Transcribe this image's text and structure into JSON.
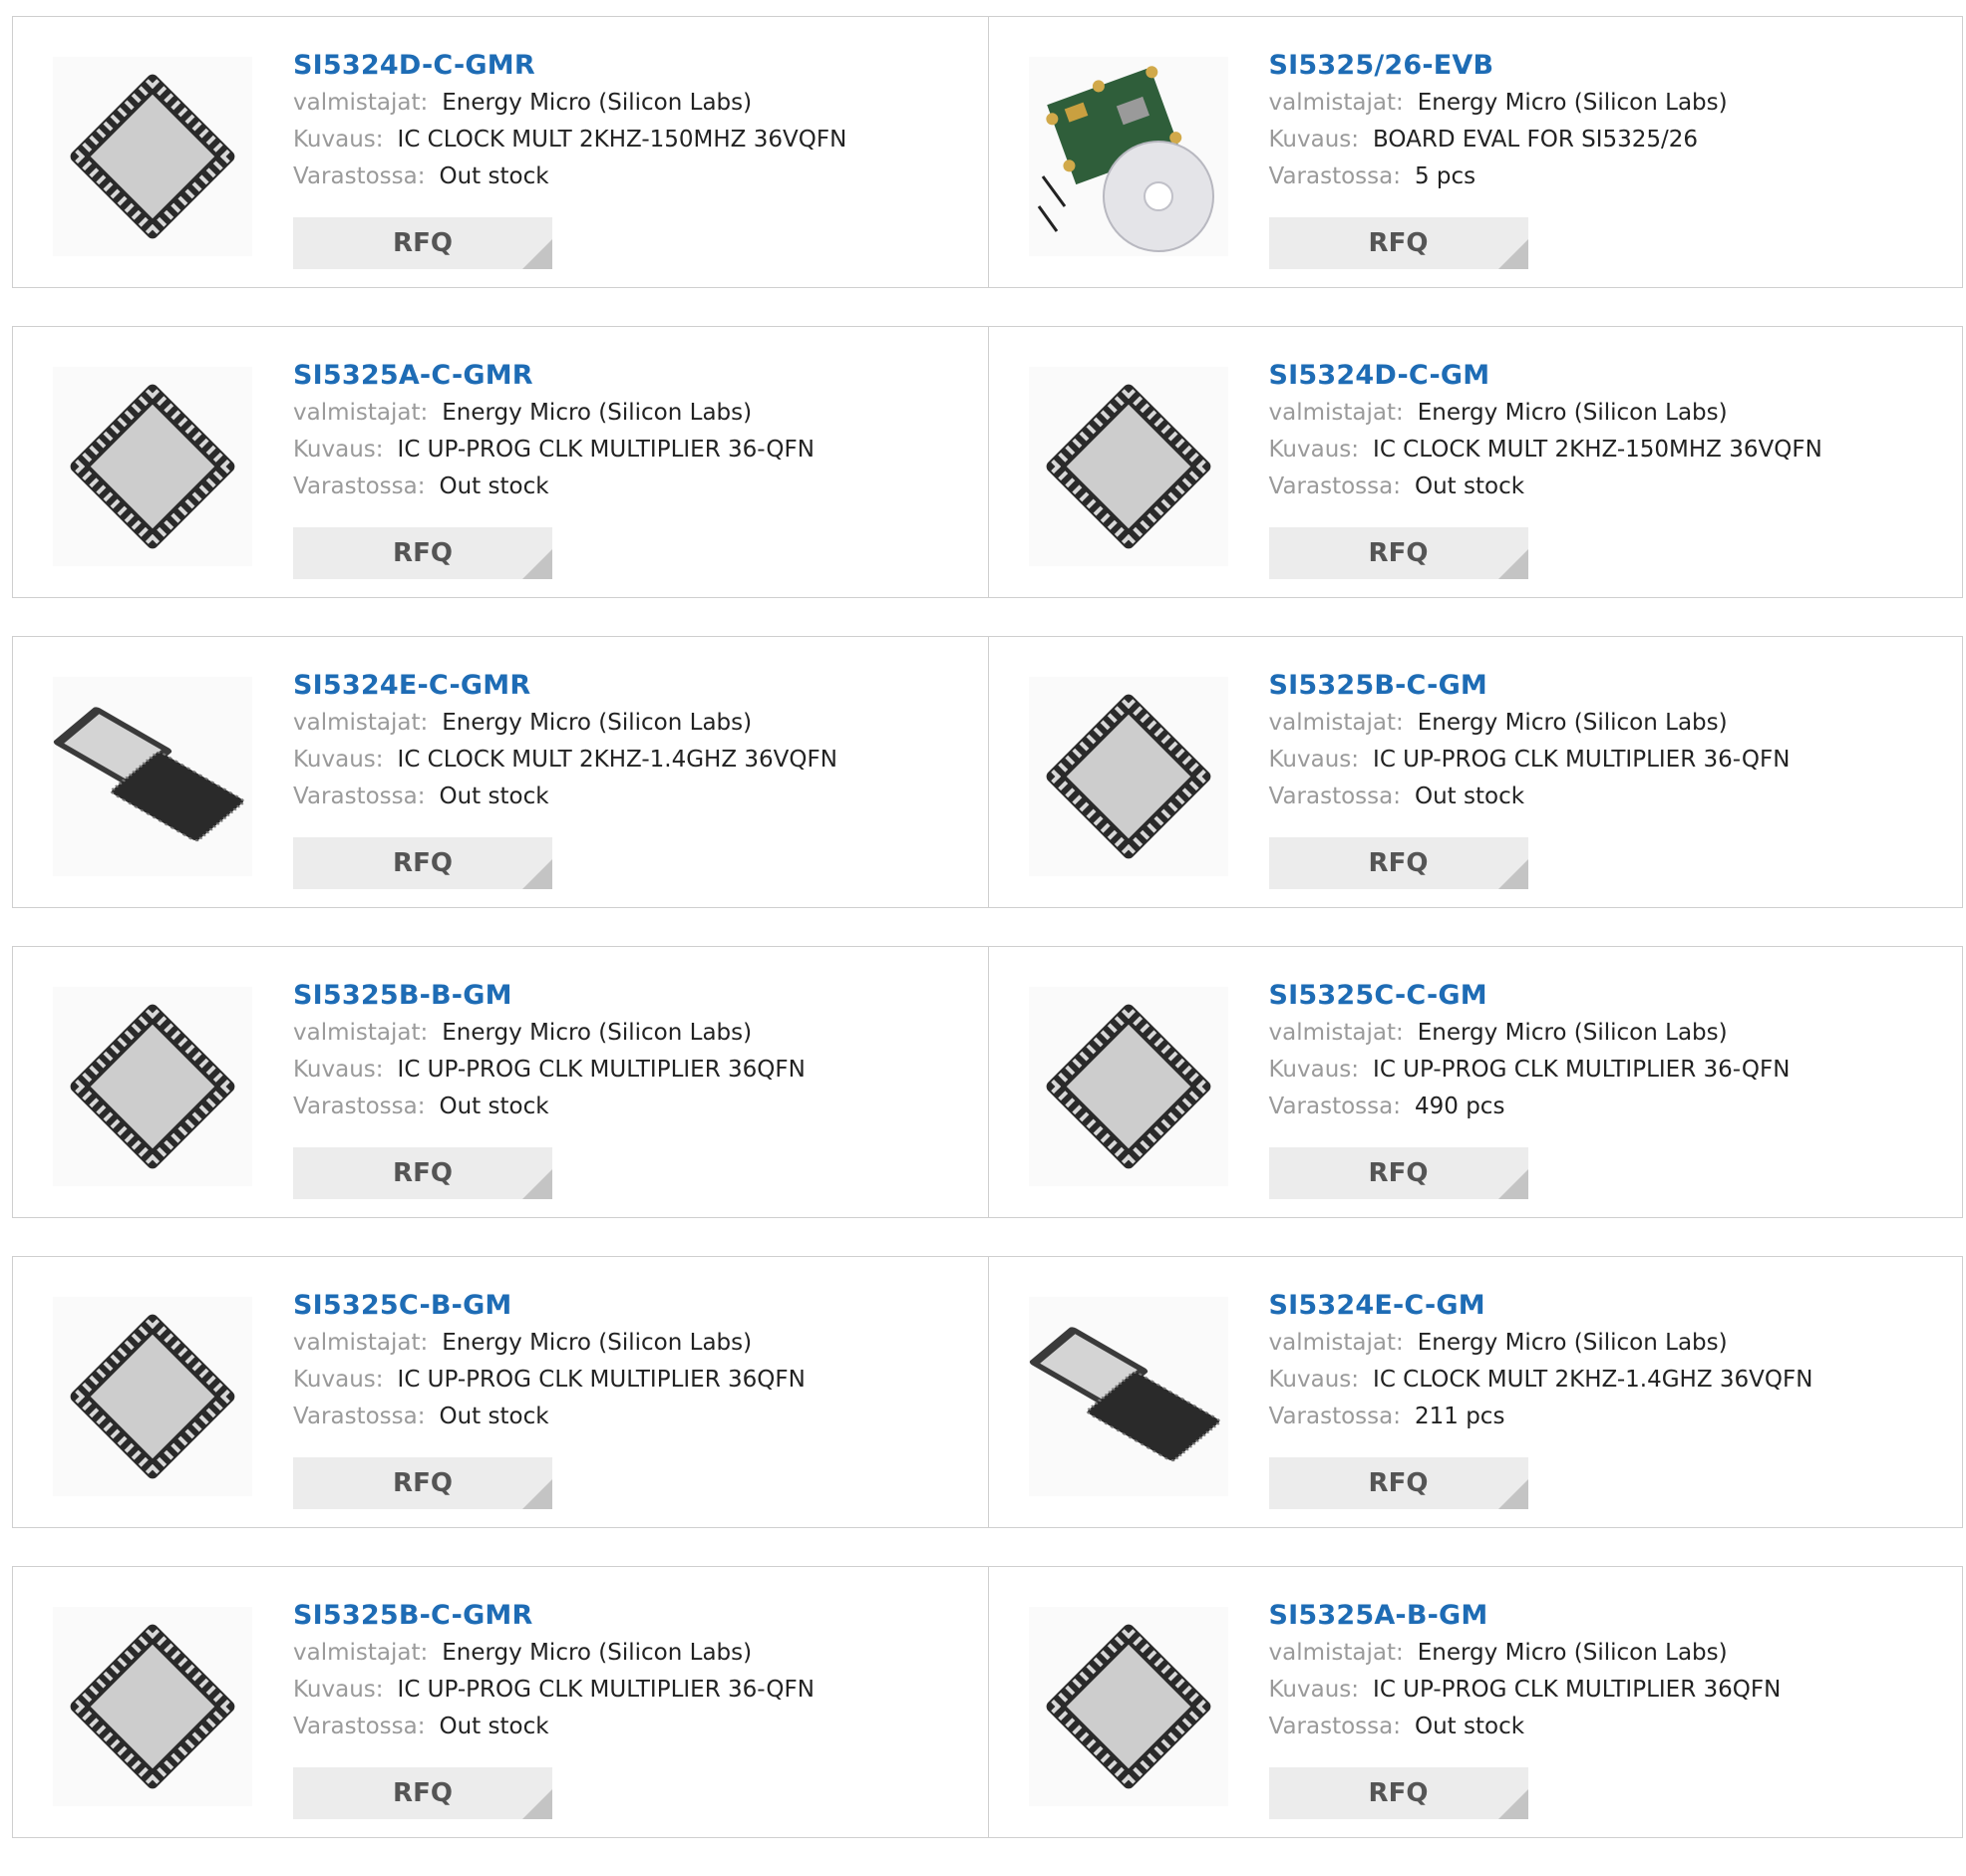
{
  "labels": {
    "manufacturer": "valmistajat:",
    "description": "Kuvaus:",
    "stock": "Varastossa:",
    "rfq": "RFQ"
  },
  "colors": {
    "part_link": "#1e6cb5",
    "label_gray": "#9a9a9a",
    "rfq_bg": "#ececec",
    "border": "#cfcfcf"
  },
  "products": [
    {
      "part": "SI5324D-C-GMR",
      "manufacturer": "Energy Micro (Silicon Labs)",
      "description": "IC CLOCK MULT 2KHZ-150MHZ 36VQFN",
      "stock": "Out stock",
      "image": "qfn-chip-icon"
    },
    {
      "part": "SI5325/26-EVB",
      "manufacturer": "Energy Micro (Silicon Labs)",
      "description": "BOARD EVAL FOR SI5325/26",
      "stock": "5 pcs",
      "image": "eval-board-icon"
    },
    {
      "part": "SI5325A-C-GMR",
      "manufacturer": "Energy Micro (Silicon Labs)",
      "description": "IC UP-PROG CLK MULTIPLIER 36-QFN",
      "stock": "Out stock",
      "image": "qfn-chip-icon"
    },
    {
      "part": "SI5324D-C-GM",
      "manufacturer": "Energy Micro (Silicon Labs)",
      "description": "IC CLOCK MULT 2KHZ-150MHZ 36VQFN",
      "stock": "Out stock",
      "image": "qfn-chip-icon"
    },
    {
      "part": "SI5324E-C-GMR",
      "manufacturer": "Energy Micro (Silicon Labs)",
      "description": "IC CLOCK MULT 2KHZ-1.4GHZ 36VQFN",
      "stock": "Out stock",
      "image": "qfn-chip-pair-icon"
    },
    {
      "part": "SI5325B-C-GM",
      "manufacturer": "Energy Micro (Silicon Labs)",
      "description": "IC UP-PROG CLK MULTIPLIER 36-QFN",
      "stock": "Out stock",
      "image": "qfn-chip-icon"
    },
    {
      "part": "SI5325B-B-GM",
      "manufacturer": "Energy Micro (Silicon Labs)",
      "description": "IC UP-PROG CLK MULTIPLIER 36QFN",
      "stock": "Out stock",
      "image": "qfn-chip-icon"
    },
    {
      "part": "SI5325C-C-GM",
      "manufacturer": "Energy Micro (Silicon Labs)",
      "description": "IC UP-PROG CLK MULTIPLIER 36-QFN",
      "stock": "490 pcs",
      "image": "qfn-chip-icon"
    },
    {
      "part": "SI5325C-B-GM",
      "manufacturer": "Energy Micro (Silicon Labs)",
      "description": "IC UP-PROG CLK MULTIPLIER 36QFN",
      "stock": "Out stock",
      "image": "qfn-chip-icon"
    },
    {
      "part": "SI5324E-C-GM",
      "manufacturer": "Energy Micro (Silicon Labs)",
      "description": "IC CLOCK MULT 2KHZ-1.4GHZ 36VQFN",
      "stock": "211 pcs",
      "image": "qfn-chip-pair-icon"
    },
    {
      "part": "SI5325B-C-GMR",
      "manufacturer": "Energy Micro (Silicon Labs)",
      "description": "IC UP-PROG CLK MULTIPLIER 36-QFN",
      "stock": "Out stock",
      "image": "qfn-chip-icon"
    },
    {
      "part": "SI5325A-B-GM",
      "manufacturer": "Energy Micro (Silicon Labs)",
      "description": "IC UP-PROG CLK MULTIPLIER 36QFN",
      "stock": "Out stock",
      "image": "qfn-chip-icon"
    }
  ]
}
